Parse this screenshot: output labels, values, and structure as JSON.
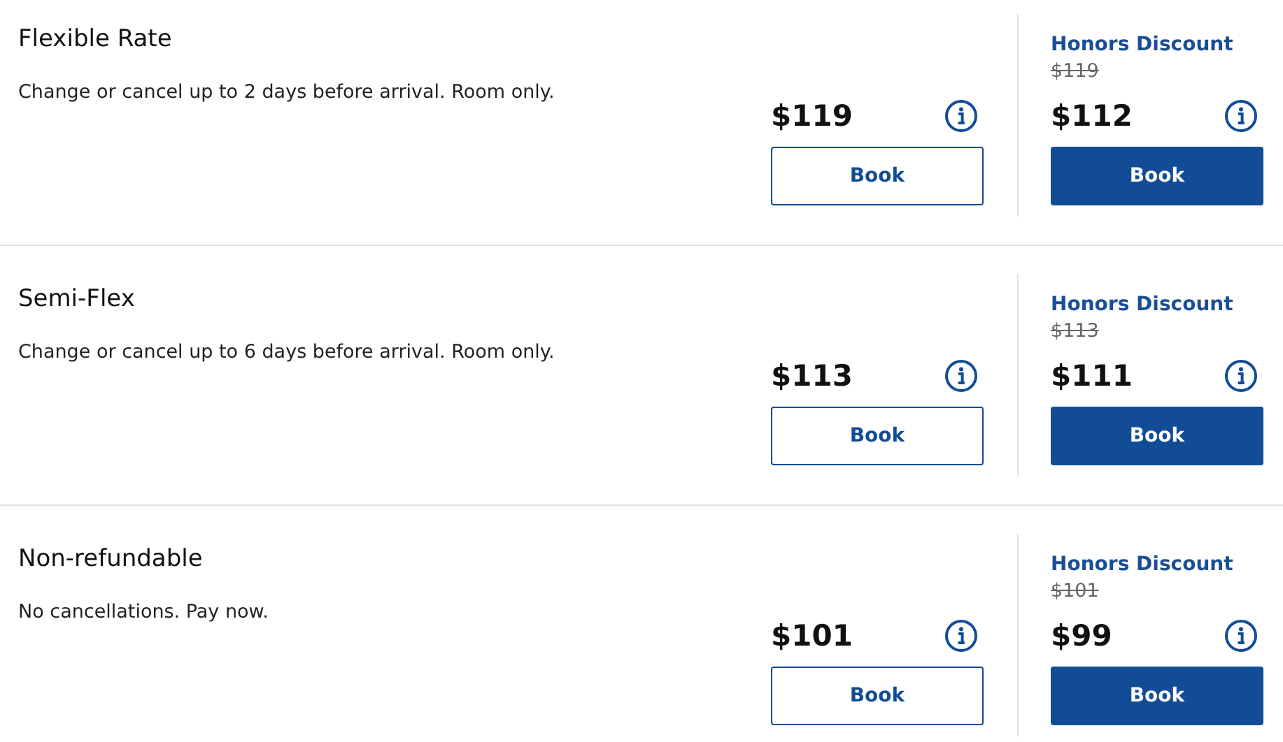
{
  "rates": [
    {
      "title": "Flexible Rate",
      "description": "Change or cancel up to 2 days before arrival. Room only.",
      "price": "$119",
      "book_label": "Book",
      "honors": {
        "label": "Honors Discount",
        "original_price": "$119",
        "price": "$112",
        "book_label": "Book"
      }
    },
    {
      "title": "Semi-Flex",
      "description": "Change or cancel up to 6 days before arrival. Room only.",
      "price": "$113",
      "book_label": "Book",
      "honors": {
        "label": "Honors Discount",
        "original_price": "$113",
        "price": "$111",
        "book_label": "Book"
      }
    },
    {
      "title": "Non-refundable",
      "description": "No cancellations. Pay now.",
      "price": "$101",
      "book_label": "Book",
      "honors": {
        "label": "Honors Discount",
        "original_price": "$101",
        "price": "$99",
        "book_label": "Book"
      }
    }
  ]
}
